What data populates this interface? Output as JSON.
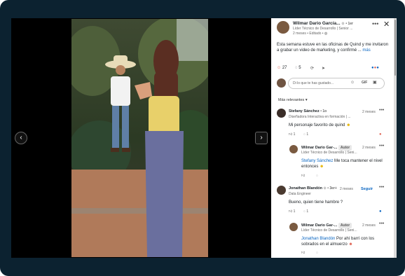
{
  "post": {
    "author": "Wilmar Dario García...",
    "degree": "• 1er",
    "headline": "Líder Técnico de Desarrollo | Senior ...",
    "meta": "2 meses • Editado •",
    "text": "Esta semana estuve en las oficinas de Quind y me invitaron a grabar un video de marketing, y confirmé ...",
    "mention": "Quind",
    "more": "más",
    "reactions_count": "27",
    "comments_count": "5",
    "close_icon": "close-icon"
  },
  "composer": {
    "placeholder": "Di lo que te has gustado...",
    "gif_label": "GIF"
  },
  "sort": {
    "label": "Más relevantes"
  },
  "comments": [
    {
      "author": "Stefany Sánchez",
      "degree": "• 1o",
      "headline": "Diseñadora Interactiva en formación | ...",
      "time": "2 meses",
      "text": "Mi personaje favorito de quind",
      "likes": "1",
      "replies": "1",
      "reply": {
        "author": "Wilmar Dario Gar-...",
        "badge": "Autor",
        "time": "2 meses",
        "headline": "Líder Técnico de Desarrollo | Seni...",
        "mention": "Stefany Sánchez",
        "text": "Me toca mantener el nivel entonces"
      }
    },
    {
      "author": "Jonathan Blandón",
      "degree": "• 3er+",
      "time": "2 meses",
      "follow": "Seguir",
      "headline": "Data Engineer",
      "text": "Bueno, quien tiene hambre ?",
      "likes": "1",
      "replies": "1",
      "reply": {
        "author": "Wilmar Dario Gar-...",
        "badge": "Autor",
        "time": "2 meses",
        "headline": "Líder Técnico de Desarrollo | Seni...",
        "mention": "Jonathan Blandón",
        "text": "Por ahí barrí con los sobrados en el almuerzo"
      }
    }
  ]
}
